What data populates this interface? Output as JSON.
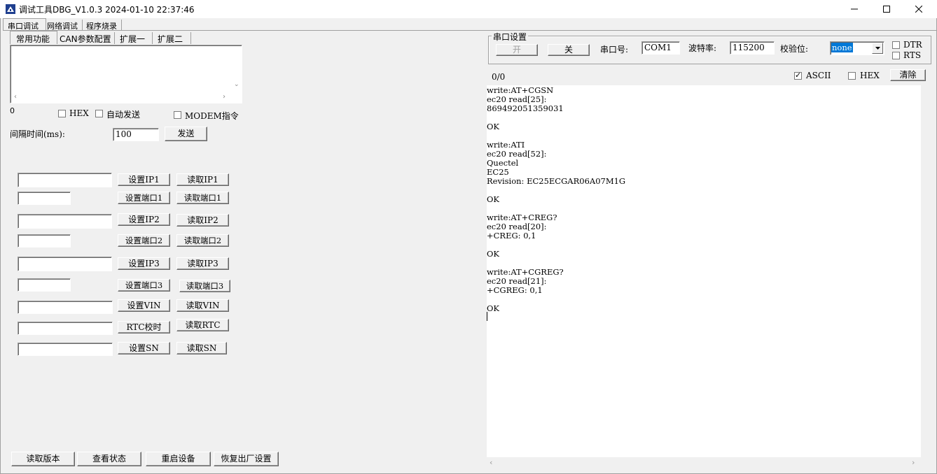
{
  "window": {
    "title": "调试工具DBG_V1.0.3 2024-01-10 22:37:46"
  },
  "top_tabs": [
    "串口调试",
    "网络调试",
    "程序烧录"
  ],
  "sub_tabs": [
    "常用功能",
    "CAN参数配置",
    "扩展一",
    "扩展二"
  ],
  "send": {
    "count": "0",
    "hex_label": "HEX",
    "auto_send_label": "自动发送",
    "modem_label": "MODEM指令",
    "interval_label": "间隔时间(ms):",
    "interval_value": "100",
    "send_button": "发送"
  },
  "config_rows": [
    {
      "value": "",
      "set": "设置IP1",
      "get": "读取IP1"
    },
    {
      "value": "",
      "set": "设置端口1",
      "get": "读取端口1"
    },
    {
      "value": "",
      "set": "设置IP2",
      "get": "读取IP2"
    },
    {
      "value": "",
      "set": "设置端口2",
      "get": "读取端口2"
    },
    {
      "value": "",
      "set": "设置IP3",
      "get": "读取IP3"
    },
    {
      "value": "",
      "set": "设置端口3",
      "get": "读取端口3"
    },
    {
      "value": "",
      "set": "设置VIN",
      "get": "读取VIN"
    },
    {
      "value": "",
      "set": "RTC校时",
      "get": "读取RTC"
    },
    {
      "value": "",
      "set": "设置SN",
      "get": "读取SN"
    }
  ],
  "bottom_buttons": [
    "读取版本",
    "查看状态",
    "重启设备",
    "恢复出厂设置"
  ],
  "serial": {
    "group_label": "串口设置",
    "open_button": "开",
    "close_button": "关",
    "port_label": "串口号:",
    "port_value": "COM1",
    "baud_label": "波特率:",
    "baud_value": "115200",
    "parity_label": "校验位:",
    "parity_value": "none",
    "dtr_label": "DTR",
    "rts_label": "RTS"
  },
  "receive": {
    "counter": "0/0",
    "ascii_label": "ASCII",
    "ascii_checked": true,
    "hex_label": "HEX",
    "hex_checked": false,
    "clear_button": "清除",
    "log": "write:AT+CGSN\nec20 read[25]:\n869492051359031\n\nOK\n\nwrite:ATI\nec20 read[52]:\nQuectel\nEC25\nRevision: EC25ECGAR06A07M1G\n\nOK\n\nwrite:AT+CREG?\nec20 read[20]:\n+CREG: 0,1\n\nOK\n\nwrite:AT+CGREG?\nec20 read[21]:\n+CGREG: 0,1\n\nOK\n"
  }
}
